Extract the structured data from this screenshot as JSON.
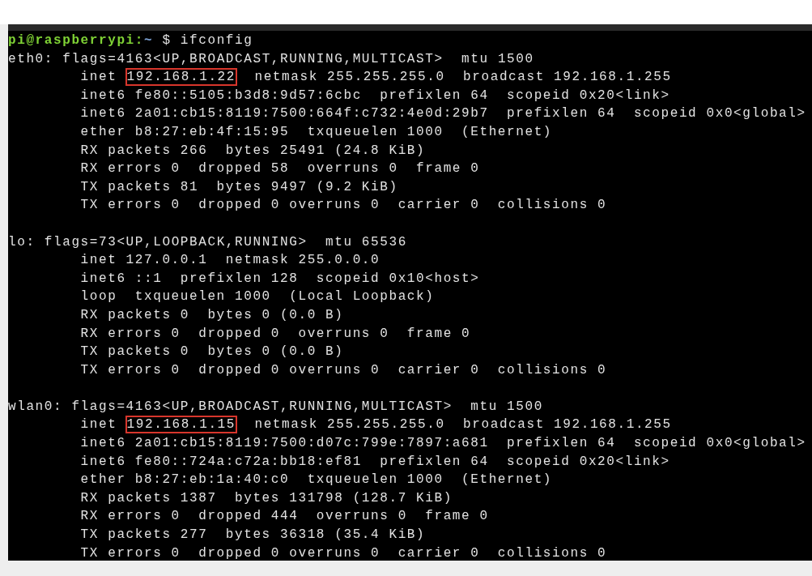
{
  "prompt": {
    "user_host": "pi@raspberrypi:",
    "path": "~",
    "sign": "$",
    "command": "ifconfig"
  },
  "interfaces": [
    {
      "header": "eth0: flags=4163<UP,BROADCAST,RUNNING,MULTICAST>  mtu 1500",
      "lines": [
        {
          "segments": [
            {
              "text": "inet ",
              "highlighted": false
            },
            {
              "text": "192.168.1.22",
              "highlighted": true
            },
            {
              "text": "  netmask 255.255.255.0  broadcast 192.168.1.255",
              "highlighted": false
            }
          ]
        },
        {
          "text": "inet6 fe80::5105:b3d8:9d57:6cbc  prefixlen 64  scopeid 0x20<link>"
        },
        {
          "text": "inet6 2a01:cb15:8119:7500:664f:c732:4e0d:29b7  prefixlen 64  scopeid 0x0<global>"
        },
        {
          "text": "ether b8:27:eb:4f:15:95  txqueuelen 1000  (Ethernet)"
        },
        {
          "text": "RX packets 266  bytes 25491 (24.8 KiB)"
        },
        {
          "text": "RX errors 0  dropped 58  overruns 0  frame 0"
        },
        {
          "text": "TX packets 81  bytes 9497 (9.2 KiB)"
        },
        {
          "text": "TX errors 0  dropped 0 overruns 0  carrier 0  collisions 0"
        }
      ]
    },
    {
      "header": "lo: flags=73<UP,LOOPBACK,RUNNING>  mtu 65536",
      "lines": [
        {
          "text": "inet 127.0.0.1  netmask 255.0.0.0"
        },
        {
          "text": "inet6 ::1  prefixlen 128  scopeid 0x10<host>"
        },
        {
          "text": "loop  txqueuelen 1000  (Local Loopback)"
        },
        {
          "text": "RX packets 0  bytes 0 (0.0 B)"
        },
        {
          "text": "RX errors 0  dropped 0  overruns 0  frame 0"
        },
        {
          "text": "TX packets 0  bytes 0 (0.0 B)"
        },
        {
          "text": "TX errors 0  dropped 0 overruns 0  carrier 0  collisions 0"
        }
      ]
    },
    {
      "header": "wlan0: flags=4163<UP,BROADCAST,RUNNING,MULTICAST>  mtu 1500",
      "lines": [
        {
          "segments": [
            {
              "text": "inet ",
              "highlighted": false
            },
            {
              "text": "192.168.1.15",
              "highlighted": true
            },
            {
              "text": "  netmask 255.255.255.0  broadcast 192.168.1.255",
              "highlighted": false
            }
          ]
        },
        {
          "text": "inet6 2a01:cb15:8119:7500:d07c:799e:7897:a681  prefixlen 64  scopeid 0x0<global>"
        },
        {
          "text": "inet6 fe80::724a:c72a:bb18:ef81  prefixlen 64  scopeid 0x20<link>"
        },
        {
          "text": "ether b8:27:eb:1a:40:c0  txqueuelen 1000  (Ethernet)"
        },
        {
          "text": "RX packets 1387  bytes 131798 (128.7 KiB)"
        },
        {
          "text": "RX errors 0  dropped 444  overruns 0  frame 0"
        },
        {
          "text": "TX packets 277  bytes 36318 (35.4 KiB)"
        },
        {
          "text": "TX errors 0  dropped 0 overruns 0  carrier 0  collisions 0"
        }
      ]
    }
  ]
}
